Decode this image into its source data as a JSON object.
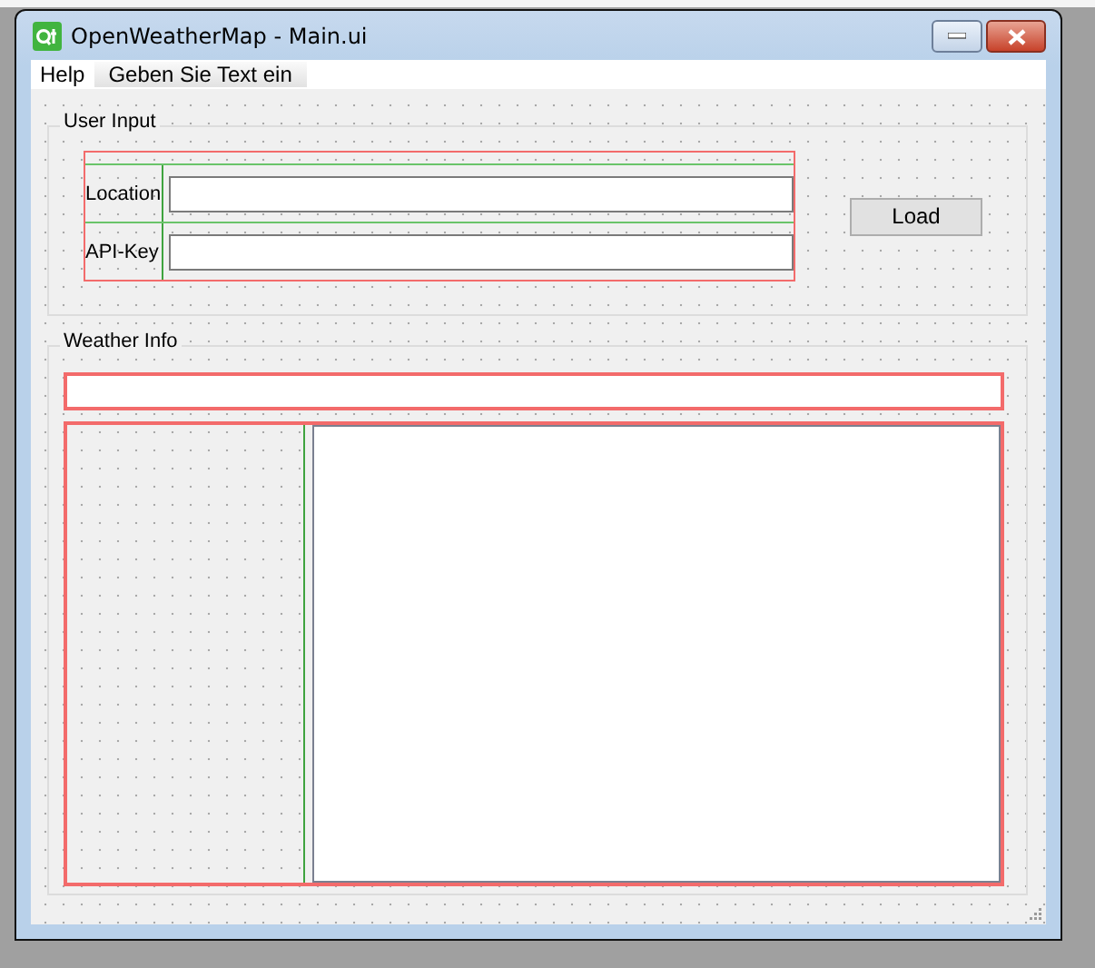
{
  "window": {
    "title": "OpenWeatherMap - Main.ui"
  },
  "menu": [
    {
      "label": "Help",
      "kind": "menu"
    },
    {
      "label": "Geben Sie Text ein",
      "kind": "placeholder"
    }
  ],
  "user_input": {
    "title": "User Input",
    "fields": [
      {
        "label": "Location"
      },
      {
        "label": "API-Key"
      }
    ],
    "button": "Load"
  },
  "weather_info": {
    "title": "Weather Info"
  }
}
